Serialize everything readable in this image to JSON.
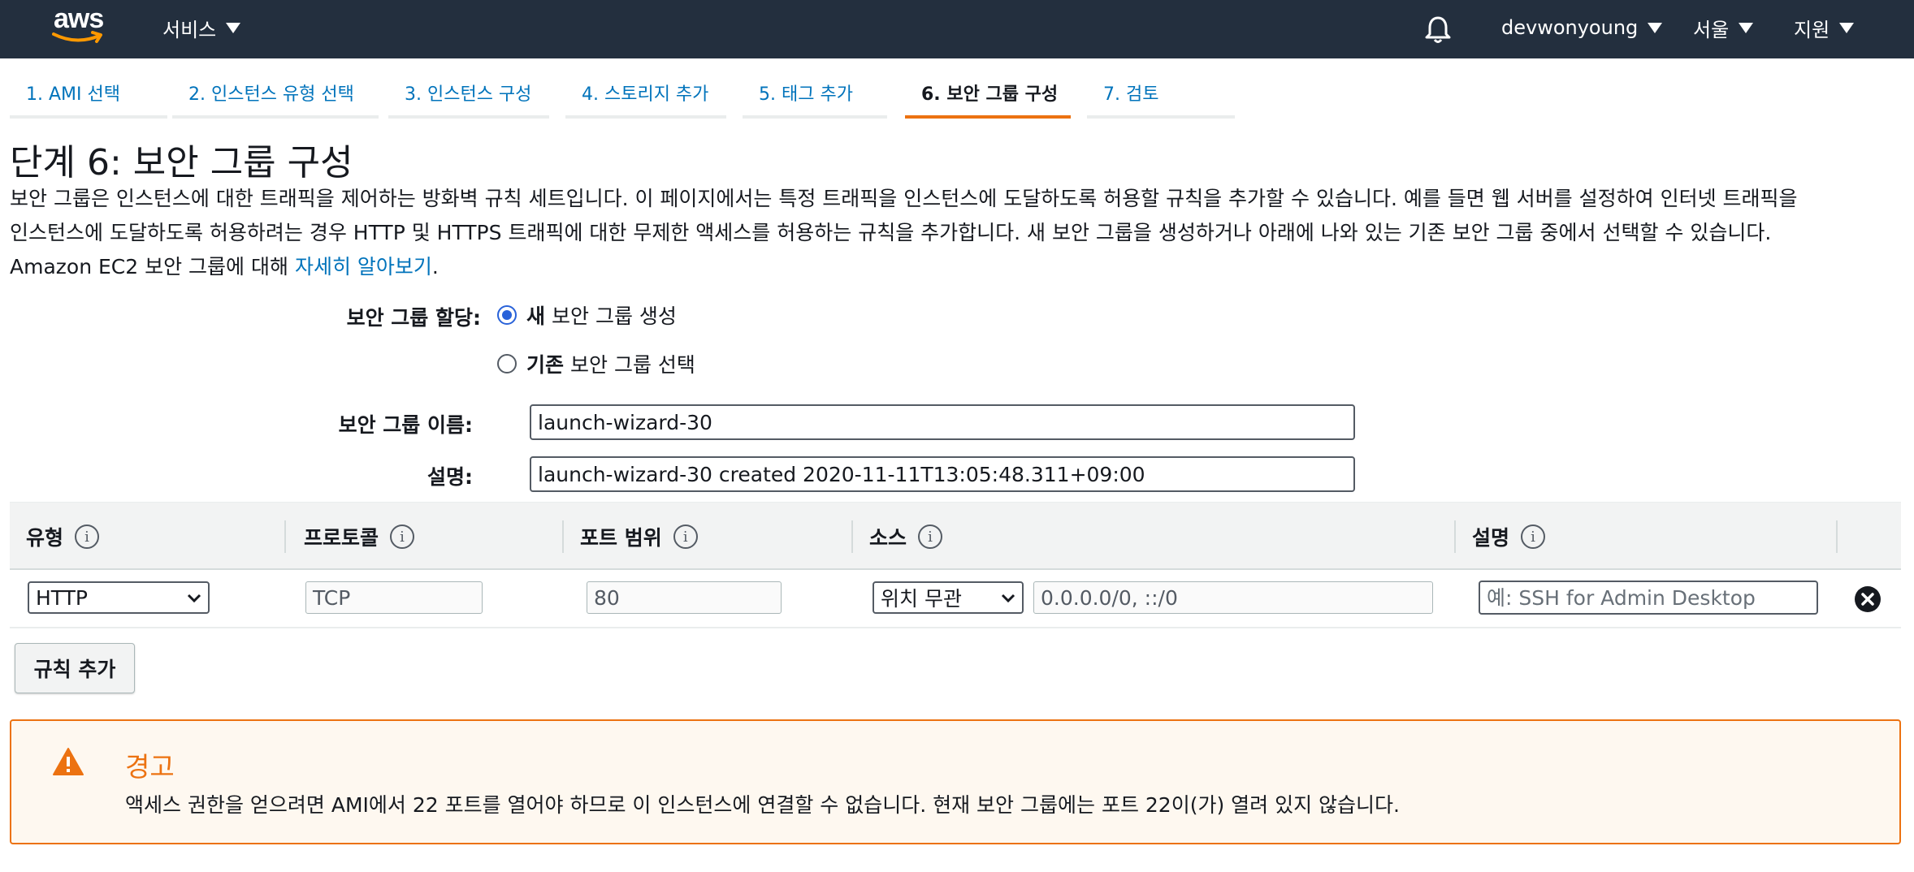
{
  "nav": {
    "logo": "aws",
    "services": "서비스",
    "user": "devwonyoung",
    "region": "서울",
    "support": "지원"
  },
  "tabs": [
    {
      "label": "1. AMI 선택"
    },
    {
      "label": "2. 인스턴스 유형 선택"
    },
    {
      "label": "3. 인스턴스 구성"
    },
    {
      "label": "4. 스토리지 추가"
    },
    {
      "label": "5. 태그 추가"
    },
    {
      "label": "6. 보안 그룹 구성",
      "active": true
    },
    {
      "label": "7. 검토"
    }
  ],
  "page": {
    "title": "단계 6: 보안 그룹 구성",
    "intro_line1": "보안 그룹은 인스턴스에 대한 트래픽을 제어하는 방화벽 규칙 세트입니다. 이 페이지에서는 특정 트래픽을 인스턴스에 도달하도록 허용할 규칙을 추가할 수 있습니다. 예를 들면 웹 서버를 설정하여 인터넷 트래픽을",
    "intro_line2": "인스턴스에 도달하도록 허용하려는 경우 HTTP 및 HTTPS 트래픽에 대한 무제한 액세스를 허용하는 규칙을 추가합니다. 새 보안 그룹을 생성하거나 아래에 나와 있는 기존 보안 그룹 중에서 선택할 수 있습니다.",
    "intro_line3": "Amazon EC2 보안 그룹에 대해 ",
    "learn_more": "자세히 알아보기",
    "period": "."
  },
  "form": {
    "assign_label": "보안 그룹 할당:",
    "option_new_bold": "새",
    "option_new_rest": "보안 그룹 생성",
    "option_existing_bold": "기존",
    "option_existing_rest": "보안 그룹 선택",
    "name_label": "보안 그룹 이름:",
    "name_value": "launch-wizard-30",
    "desc_label": "설명:",
    "desc_value": "launch-wizard-30 created 2020-11-11T13:05:48.311+09:00"
  },
  "table": {
    "headers": {
      "type": "유형",
      "protocol": "프로토콜",
      "port_range": "포트 범위",
      "source": "소스",
      "description": "설명"
    },
    "info_glyph": "i",
    "rows": [
      {
        "type": "HTTP",
        "protocol": "TCP",
        "port": "80",
        "source_type": "위치 무관",
        "source_cidr": "0.0.0.0/0, ::/0",
        "description_placeholder": "예: SSH for Admin Desktop"
      }
    ]
  },
  "add_rule_label": "규칙 추가",
  "warning": {
    "title": "경고",
    "text": "액세스 권한을 얻으려면 AMI에서 22 포트를 열어야 하므로 이 인스턴스에 연결할 수 없습니다. 현재 보안 그룹에는 포트 22이(가) 열려 있지 않습니다."
  },
  "colors": {
    "nav_bg": "#232f3e",
    "link": "#0073bb",
    "accent": "#ec7211",
    "warning_bg": "#fef8f0"
  }
}
